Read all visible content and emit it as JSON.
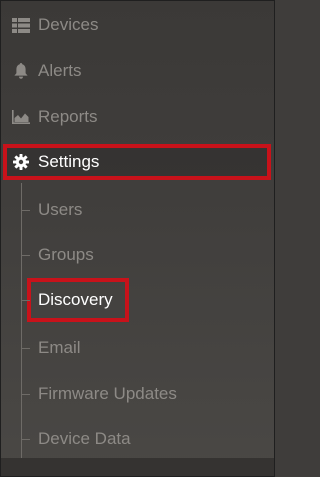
{
  "menu": {
    "items": [
      {
        "label": "Devices",
        "icon": "grid-list-icon"
      },
      {
        "label": "Alerts",
        "icon": "bell-icon"
      },
      {
        "label": "Reports",
        "icon": "area-chart-icon"
      },
      {
        "label": "Settings",
        "icon": "gear-icon"
      }
    ],
    "settings_submenu": [
      {
        "label": "Users"
      },
      {
        "label": "Groups"
      },
      {
        "label": "Discovery"
      },
      {
        "label": "Email"
      },
      {
        "label": "Firmware Updates"
      },
      {
        "label": "Device Data"
      }
    ],
    "active_item": "Settings",
    "active_subitem": "Discovery"
  },
  "colors": {
    "highlight_border": "#c8121a",
    "inactive_text": "#8d8a86",
    "active_text": "#ffffff",
    "background": "#403e3c"
  }
}
